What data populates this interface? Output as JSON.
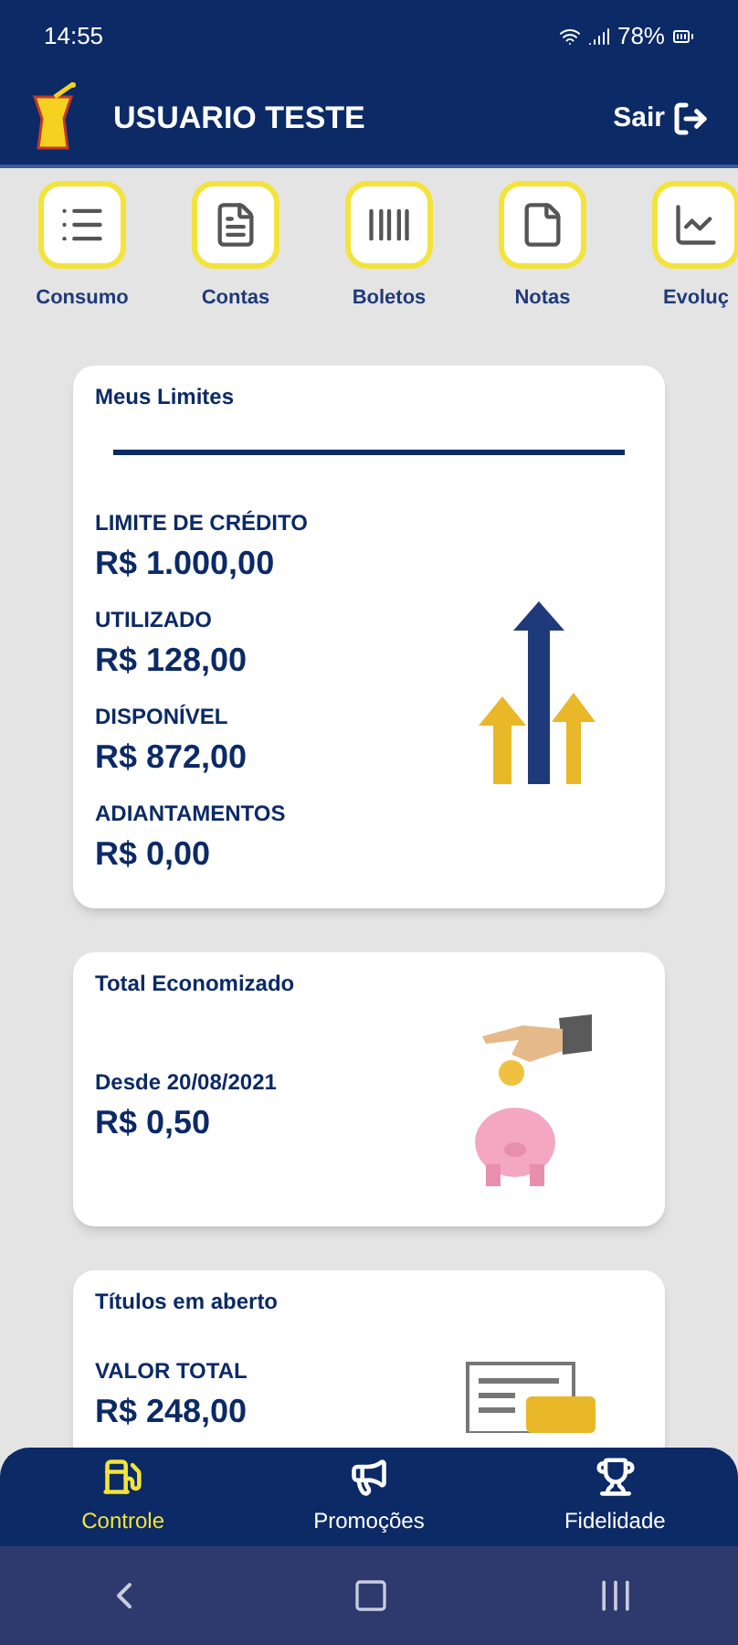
{
  "status_bar": {
    "time": "14:55",
    "battery": "78%"
  },
  "header": {
    "user": "USUARIO TESTE",
    "logout": "Sair"
  },
  "shortcuts": [
    {
      "label": "Consumo",
      "kind": "list"
    },
    {
      "label": "Contas",
      "kind": "bill"
    },
    {
      "label": "Boletos",
      "kind": "barcode"
    },
    {
      "label": "Notas",
      "kind": "file"
    },
    {
      "label": "Evoluç",
      "kind": "chart"
    }
  ],
  "cards": [
    {
      "kind": "limits",
      "title": "Meus Limites",
      "rows": [
        {
          "label": "LIMITE DE CRÉDITO",
          "value": "R$ 1.000,00"
        },
        {
          "label": "UTILIZADO",
          "value": "R$ 128,00"
        },
        {
          "label": "DISPONÍVEL",
          "value": "R$ 872,00"
        },
        {
          "label": "ADIANTAMENTOS",
          "value": "R$ 0,00"
        }
      ]
    },
    {
      "kind": "savings",
      "title": "Total Economizado",
      "rows": [
        {
          "label": "Desde 20/08/2021",
          "value": "R$ 0,50"
        }
      ]
    },
    {
      "kind": "bills",
      "title": "Títulos em aberto",
      "rows": [
        {
          "label": "VALOR TOTAL",
          "value": "R$ 248,00"
        }
      ]
    }
  ],
  "bottom_nav": [
    {
      "label": "Controle",
      "kind": "fuel",
      "selected": true
    },
    {
      "label": "Promoções",
      "kind": "megaphone",
      "selected": false
    },
    {
      "label": "Fidelidade",
      "kind": "trophy",
      "selected": false
    }
  ]
}
